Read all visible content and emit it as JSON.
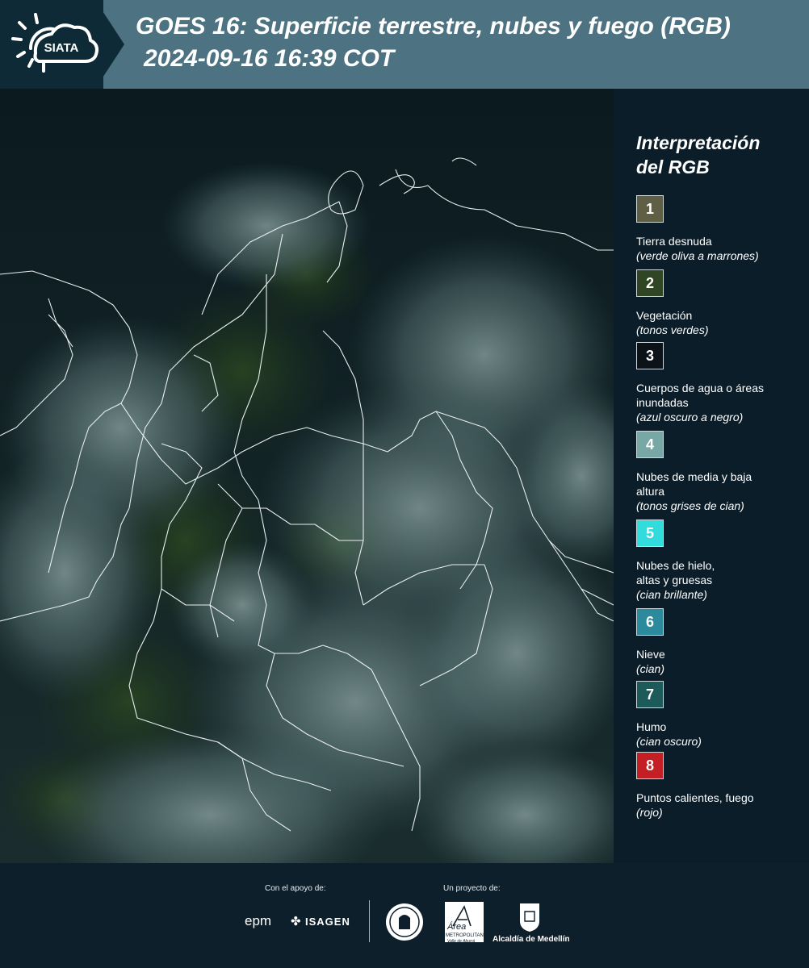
{
  "header": {
    "logo_text": "SIATA",
    "title": "GOES 16: Superficie terrestre, nubes y fuego (RGB)",
    "datetime": "2024-09-16 16:39 COT"
  },
  "legend": {
    "title_line1": "Interpretación",
    "title_line2": "del RGB",
    "items": [
      {
        "num": "1",
        "label": "Tierra desnuda",
        "note": "(verde oliva a marrones)",
        "color": "#5f5f45"
      },
      {
        "num": "2",
        "label": "Vegetación",
        "note": "(tonos verdes)",
        "color": "#2f4523"
      },
      {
        "num": "3",
        "label": "Cuerpos de agua o áreas inundadas",
        "note": "(azul oscuro a negro)",
        "color": "#0b1218"
      },
      {
        "num": "4",
        "label": "Nubes de media y baja altura",
        "note": "(tonos grises de cian)",
        "color": "#78a8a6"
      },
      {
        "num": "5",
        "label": "Nubes de hielo, altas y gruesas",
        "note": "(cian brillante)",
        "color": "#33dcdc"
      },
      {
        "num": "6",
        "label": "Nieve",
        "note": "(cian)",
        "color": "#2b8a9c"
      },
      {
        "num": "7",
        "label": "Humo",
        "note": "(cian oscuro)",
        "color": "#1d5a5a"
      },
      {
        "num": "8",
        "label": "Puntos calientes, fuego",
        "note": "(rojo)",
        "color": "#c31f24"
      }
    ]
  },
  "footer": {
    "support_label": "Con el apoyo de:",
    "project_label": "Un proyecto de:",
    "epm": "epm",
    "isagen": "ISAGEN",
    "area_word": "Área",
    "area_sub1": "METROPOLITANA",
    "area_sub2": "Valle de Aburrá",
    "medellin": "Alcaldía de Medellín"
  }
}
